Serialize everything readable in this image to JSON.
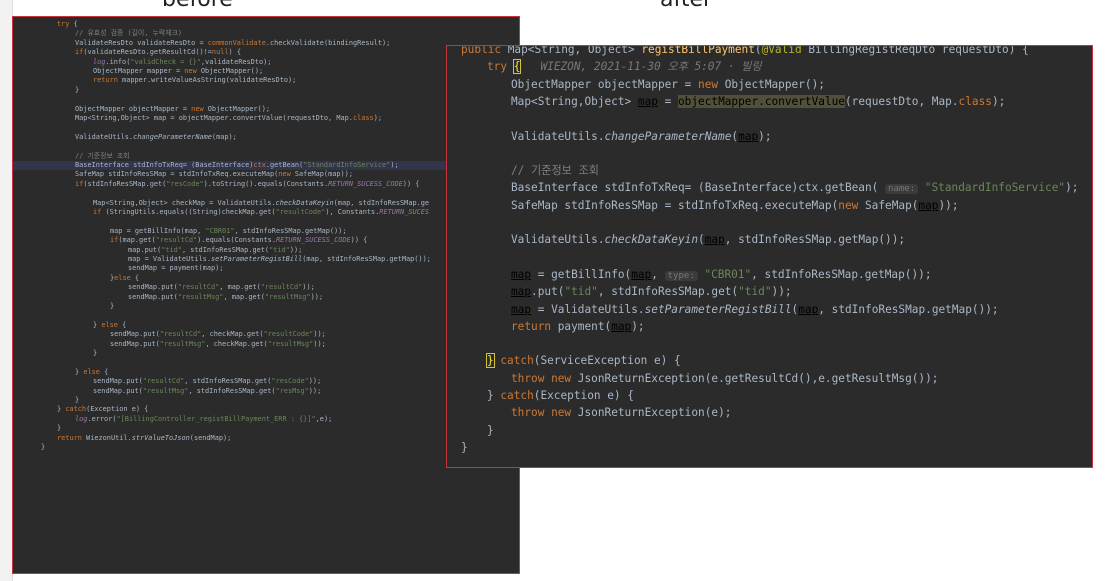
{
  "captions": {
    "before": "before",
    "after": "after"
  },
  "before_lines": [
    [
      [
        "kw",
        "try"
      ],
      [
        "plain",
        " {"
      ]
    ],
    [
      [
        "cm",
        "// 유효성 검증 (길이, 누락체크)"
      ]
    ],
    [
      [
        "plain",
        "ValidateResDto validateResDto = "
      ],
      [
        "kw",
        "commonValidate"
      ],
      [
        "plain",
        ".checkValidate(bindingResult);"
      ]
    ],
    [
      [
        "kw",
        "if"
      ],
      [
        "plain",
        "(validateResDto.getResultCd()!="
      ],
      [
        "kw",
        "null"
      ],
      [
        "plain",
        ") {"
      ]
    ],
    [
      [
        "itc",
        "log"
      ],
      [
        "plain",
        ".info("
      ],
      [
        "str",
        "\"validCheck = {}\""
      ],
      [
        "plain",
        ",validateResDto);"
      ]
    ],
    [
      [
        "plain",
        "ObjectMapper mapper = "
      ],
      [
        "kw",
        "new"
      ],
      [
        "plain",
        " ObjectMapper();"
      ]
    ],
    [
      [
        "kw",
        "return"
      ],
      [
        "plain",
        " mapper.writeValueAsString(validateResDto);"
      ]
    ],
    [
      [
        "plain",
        "}"
      ]
    ],
    [
      [
        "plain",
        ""
      ]
    ],
    [
      [
        "plain",
        "ObjectMapper objectMapper = "
      ],
      [
        "kw",
        "new"
      ],
      [
        "plain",
        " ObjectMapper();"
      ]
    ],
    [
      [
        "plain",
        "Map<String,Object> map = objectMapper.convertValue(requestDto, Map."
      ],
      [
        "kw",
        "class"
      ],
      [
        "plain",
        ");"
      ]
    ],
    [
      [
        "plain",
        ""
      ]
    ],
    [
      [
        "plain",
        "ValidateUtils."
      ],
      [
        "it",
        "changeParameterName"
      ],
      [
        "plain",
        "(map);"
      ]
    ],
    [
      [
        "plain",
        ""
      ]
    ],
    [
      [
        "cm",
        "// 기준정보 조회"
      ]
    ],
    [
      [
        "plain",
        "BaseInterface stdInfoTxReq= (BaseInterface)"
      ],
      [
        "kw",
        "ctx"
      ],
      [
        "plain",
        ".getBean("
      ],
      [
        "str",
        "\"StandardInfoService\""
      ],
      [
        "plain",
        ");"
      ]
    ],
    [
      [
        "plain",
        "SafeMap stdInfoResSMap = stdInfoTxReq.executeMap("
      ],
      [
        "kw",
        "new"
      ],
      [
        "plain",
        " SafeMap(map));"
      ]
    ],
    [
      [
        "kw",
        "if"
      ],
      [
        "plain",
        "(stdInfoResSMap.get("
      ],
      [
        "str",
        "\"resCode\""
      ],
      [
        "plain",
        ").toString().equals(Constants."
      ],
      [
        "itc",
        "RETURN_SUCESS_CODE"
      ],
      [
        "plain",
        ")) {"
      ]
    ],
    [
      [
        "plain",
        ""
      ]
    ],
    [
      [
        "plain",
        "Map<String,Object> checkMap = ValidateUtils."
      ],
      [
        "it",
        "checkDataKeyin"
      ],
      [
        "plain",
        "(map, stdInfoResSMap.ge"
      ]
    ],
    [
      [
        "kw",
        "if"
      ],
      [
        "plain",
        " (StringUtils.equals((String)checkMap.get("
      ],
      [
        "str",
        "\"resultCode\""
      ],
      [
        "plain",
        "), Constants."
      ],
      [
        "itc",
        "RETURN_SUCES"
      ]
    ],
    [
      [
        "plain",
        ""
      ]
    ],
    [
      [
        "plain",
        "map = getBillInfo(map, "
      ],
      [
        "str",
        "\"CBR01\""
      ],
      [
        "plain",
        ", stdInfoResSMap.getMap());"
      ]
    ],
    [
      [
        "kw",
        "if"
      ],
      [
        "plain",
        "(map.get("
      ],
      [
        "str",
        "\"resultCd\""
      ],
      [
        "plain",
        ").equals(Constants."
      ],
      [
        "itc",
        "RETURN_SUCESS_CODE"
      ],
      [
        "plain",
        ")) {"
      ]
    ],
    [
      [
        "plain",
        "map.put("
      ],
      [
        "str",
        "\"tid\""
      ],
      [
        "plain",
        ", stdInfoResSMap.get("
      ],
      [
        "str",
        "\"tid\""
      ],
      [
        "plain",
        "));"
      ]
    ],
    [
      [
        "plain",
        "map = ValidateUtils."
      ],
      [
        "it",
        "setParameterRegistBill"
      ],
      [
        "plain",
        "(map, stdInfoResSMap.getMap());"
      ]
    ],
    [
      [
        "plain",
        "sendMap = payment(map);"
      ]
    ],
    [
      [
        "plain",
        "}"
      ],
      [
        "kw",
        "else"
      ],
      [
        "plain",
        " {"
      ]
    ],
    [
      [
        "plain",
        "sendMap.put("
      ],
      [
        "str",
        "\"resultCd\""
      ],
      [
        "plain",
        ", map.get("
      ],
      [
        "str",
        "\"resultCd\""
      ],
      [
        "plain",
        "));"
      ]
    ],
    [
      [
        "plain",
        "sendMap.put("
      ],
      [
        "str",
        "\"resultMsg\""
      ],
      [
        "plain",
        ", map.get("
      ],
      [
        "str",
        "\"resultMsg\""
      ],
      [
        "plain",
        "));"
      ]
    ],
    [
      [
        "plain",
        "}"
      ]
    ],
    [
      [
        "plain",
        ""
      ]
    ],
    [
      [
        "plain",
        "} "
      ],
      [
        "kw",
        "else"
      ],
      [
        "plain",
        " {"
      ]
    ],
    [
      [
        "plain",
        "sendMap.put("
      ],
      [
        "str",
        "\"resultCd\""
      ],
      [
        "plain",
        ", checkMap.get("
      ],
      [
        "str",
        "\"resultCode\""
      ],
      [
        "plain",
        "));"
      ]
    ],
    [
      [
        "plain",
        "sendMap.put("
      ],
      [
        "str",
        "\"resultMsg\""
      ],
      [
        "plain",
        ", checkMap.get("
      ],
      [
        "str",
        "\"resultMsg\""
      ],
      [
        "plain",
        "));"
      ]
    ],
    [
      [
        "plain",
        "}"
      ]
    ],
    [
      [
        "plain",
        ""
      ]
    ],
    [
      [
        "plain",
        "} "
      ],
      [
        "kw",
        "else"
      ],
      [
        "plain",
        " {"
      ]
    ],
    [
      [
        "plain",
        "sendMap.put("
      ],
      [
        "str",
        "\"resultCd\""
      ],
      [
        "plain",
        ", stdInfoResSMap.get("
      ],
      [
        "str",
        "\"resCode\""
      ],
      [
        "plain",
        "));"
      ]
    ],
    [
      [
        "plain",
        "sendMap.put("
      ],
      [
        "str",
        "\"resultMsg\""
      ],
      [
        "plain",
        ", stdInfoResSMap.get("
      ],
      [
        "str",
        "\"resMsg\""
      ],
      [
        "plain",
        "));"
      ]
    ],
    [
      [
        "plain",
        "}"
      ]
    ],
    [
      [
        "plain",
        "} "
      ],
      [
        "kw",
        "catch"
      ],
      [
        "plain",
        "(Exception e) {"
      ]
    ],
    [
      [
        "itc",
        "log"
      ],
      [
        "plain",
        ".error("
      ],
      [
        "str",
        "\"[BillingController_registBillPayment_ERR : {}]\""
      ],
      [
        "plain",
        ",e);"
      ]
    ],
    [
      [
        "plain",
        "}"
      ]
    ],
    [
      [
        "kw",
        "return"
      ],
      [
        "plain",
        " WiezonUtil."
      ],
      [
        "it",
        "strValueToJson"
      ],
      [
        "plain",
        "(sendMap);"
      ]
    ],
    [
      [
        "plain",
        "}"
      ]
    ]
  ],
  "after_lines": [
    [
      [
        "kw",
        "public"
      ],
      [
        "plain",
        " Map<String, Object> "
      ],
      [
        "fn",
        "registBillPayment"
      ],
      [
        "plain",
        "("
      ],
      [
        "ann",
        "@Valid"
      ],
      [
        "plain",
        " BillingRegistReqDto requestDto) {"
      ]
    ],
    [
      [
        "kw",
        "try"
      ],
      [
        "plain",
        " "
      ],
      [
        "brk",
        "{"
      ],
      [
        "hint",
        "   WIEZON, 2021-11-30 오후 5:07 · 빌링"
      ]
    ],
    [
      [
        "plain",
        "ObjectMapper objectMapper = "
      ],
      [
        "kw",
        "new"
      ],
      [
        "plain",
        " ObjectMapper();"
      ]
    ],
    [
      [
        "plain",
        "Map<String,Object> "
      ],
      [
        "ul",
        "map"
      ],
      [
        "plain",
        " = "
      ],
      [
        "ylw",
        "objectMapper.convertValue"
      ],
      [
        "plain",
        "(requestDto, Map."
      ],
      [
        "kw",
        "class"
      ],
      [
        "plain",
        ");"
      ]
    ],
    [
      [
        "plain",
        ""
      ]
    ],
    [
      [
        "plain",
        "ValidateUtils."
      ],
      [
        "it",
        "changeParameterName"
      ],
      [
        "plain",
        "("
      ],
      [
        "ul",
        "map"
      ],
      [
        "plain",
        ");"
      ]
    ],
    [
      [
        "plain",
        ""
      ]
    ],
    [
      [
        "cm",
        "// 기준정보 조회"
      ]
    ],
    [
      [
        "plain",
        "BaseInterface stdInfoTxReq= (BaseInterface)ctx.getBean( "
      ],
      [
        "param",
        "name:"
      ],
      [
        "str",
        " \"StandardInfoService\""
      ],
      [
        "plain",
        ");"
      ]
    ],
    [
      [
        "plain",
        "SafeMap stdInfoResSMap = stdInfoTxReq.executeMap("
      ],
      [
        "kw",
        "new"
      ],
      [
        "plain",
        " SafeMap("
      ],
      [
        "ul",
        "map"
      ],
      [
        "plain",
        "));"
      ]
    ],
    [
      [
        "plain",
        ""
      ]
    ],
    [
      [
        "plain",
        "ValidateUtils."
      ],
      [
        "it",
        "checkDataKeyin"
      ],
      [
        "plain",
        "("
      ],
      [
        "ul",
        "map"
      ],
      [
        "plain",
        ", stdInfoResSMap.getMap());"
      ]
    ],
    [
      [
        "plain",
        ""
      ]
    ],
    [
      [
        "ul",
        "map"
      ],
      [
        "plain",
        " = getBillInfo("
      ],
      [
        "ul",
        "map"
      ],
      [
        "plain",
        ", "
      ],
      [
        "param",
        "type:"
      ],
      [
        "str",
        " \"CBR01\""
      ],
      [
        "plain",
        ", stdInfoResSMap.getMap());"
      ]
    ],
    [
      [
        "ul",
        "map"
      ],
      [
        "plain",
        ".put("
      ],
      [
        "str",
        "\"tid\""
      ],
      [
        "plain",
        ", stdInfoResSMap.get("
      ],
      [
        "str",
        "\"tid\""
      ],
      [
        "plain",
        "));"
      ]
    ],
    [
      [
        "ul",
        "map"
      ],
      [
        "plain",
        " = ValidateUtils."
      ],
      [
        "it",
        "setParameterRegistBill"
      ],
      [
        "plain",
        "("
      ],
      [
        "ul",
        "map"
      ],
      [
        "plain",
        ", stdInfoResSMap.getMap());"
      ]
    ],
    [
      [
        "kw",
        "return"
      ],
      [
        "plain",
        " payment("
      ],
      [
        "ul",
        "map"
      ],
      [
        "plain",
        ");"
      ]
    ],
    [
      [
        "plain",
        ""
      ]
    ],
    [
      [
        "brk",
        "}"
      ],
      [
        "plain",
        " "
      ],
      [
        "kw",
        "catch"
      ],
      [
        "plain",
        "(ServiceException e) {"
      ]
    ],
    [
      [
        "kw",
        "throw new"
      ],
      [
        "plain",
        " JsonReturnException(e.getResultCd(),e.getResultMsg());"
      ]
    ],
    [
      [
        "plain",
        "} "
      ],
      [
        "kw",
        "catch"
      ],
      [
        "plain",
        "(Exception e) {"
      ]
    ],
    [
      [
        "kw",
        "throw new"
      ],
      [
        "plain",
        " JsonReturnException(e);"
      ]
    ],
    [
      [
        "plain",
        "}"
      ]
    ],
    [
      [
        "plain",
        "}"
      ]
    ]
  ]
}
